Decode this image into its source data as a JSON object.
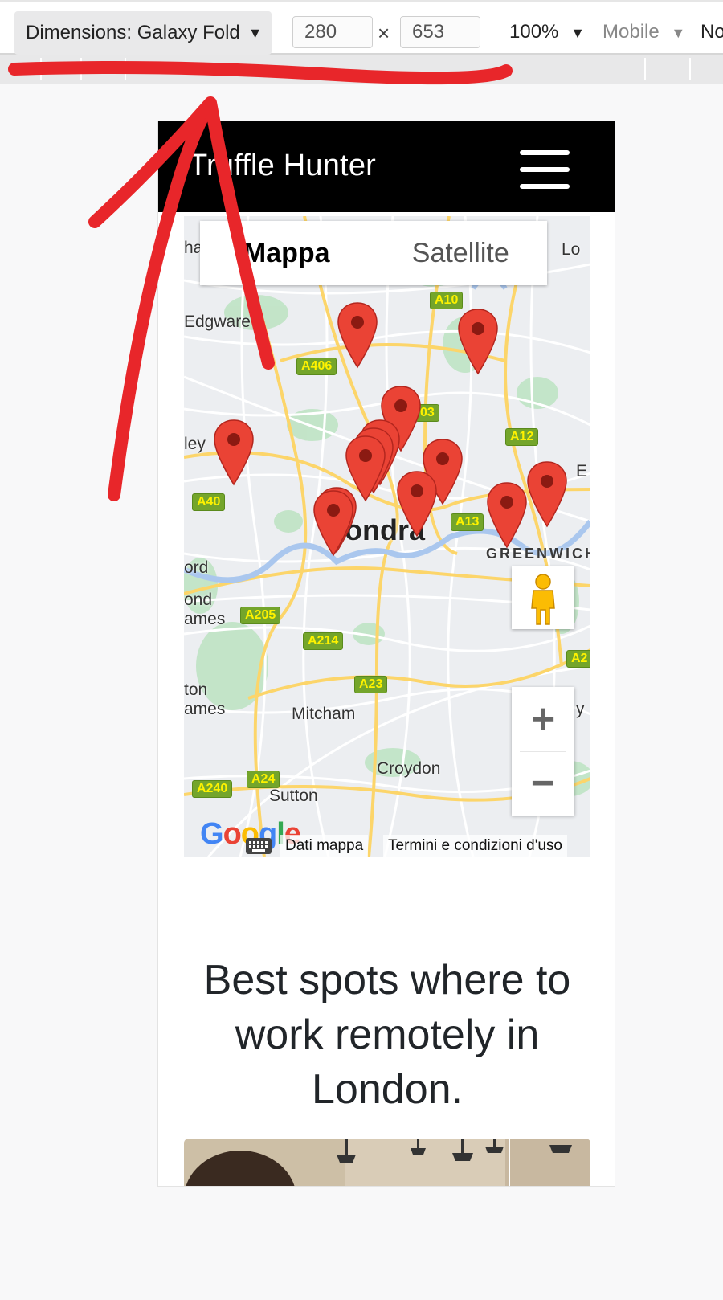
{
  "devtools": {
    "dimensions_label": "Dimensions: Galaxy Fold",
    "width_value": "280",
    "height_value": "653",
    "times_symbol": "×",
    "zoom_label": "100%",
    "device_type_label": "Mobile",
    "throttle_label_partial": "No",
    "dropdown_arrow": "▼"
  },
  "app": {
    "brand": "Truffle Hunter",
    "menu_icon": "hamburger-icon"
  },
  "map": {
    "type_map_label": "Mappa",
    "type_satellite_label": "Satellite",
    "city_label": "Londra",
    "district_label": "GREENWICH",
    "place_labels": [
      "Edgware",
      "Mitcham",
      "Croydon",
      "Sutton"
    ],
    "partial_labels": [
      "ha",
      "Lo",
      "ley",
      "E",
      "ord",
      "ond",
      "ames",
      "ton",
      "ames",
      "y"
    ],
    "road_labels": [
      "A10",
      "A406",
      "A12",
      "A40",
      "A13",
      "A205",
      "A214",
      "A23",
      "A24",
      "A240",
      "A2",
      "03"
    ],
    "attribution_data": "Dati mappa",
    "attribution_terms": "Termini e condizioni d'uso",
    "logo_text": "Google",
    "zoom_in_symbol": "+",
    "zoom_out_symbol": "−",
    "marker_count": 13,
    "colors": {
      "marker": "#ea4335",
      "marker_dot": "#8b1a12",
      "road_badge": "#74a52b",
      "road_text": "#fef200"
    }
  },
  "content": {
    "heading": "Best spots where to work remotely in London."
  },
  "annotation": {
    "color": "#e8262a",
    "shape": "hand-drawn underline and arrow"
  }
}
